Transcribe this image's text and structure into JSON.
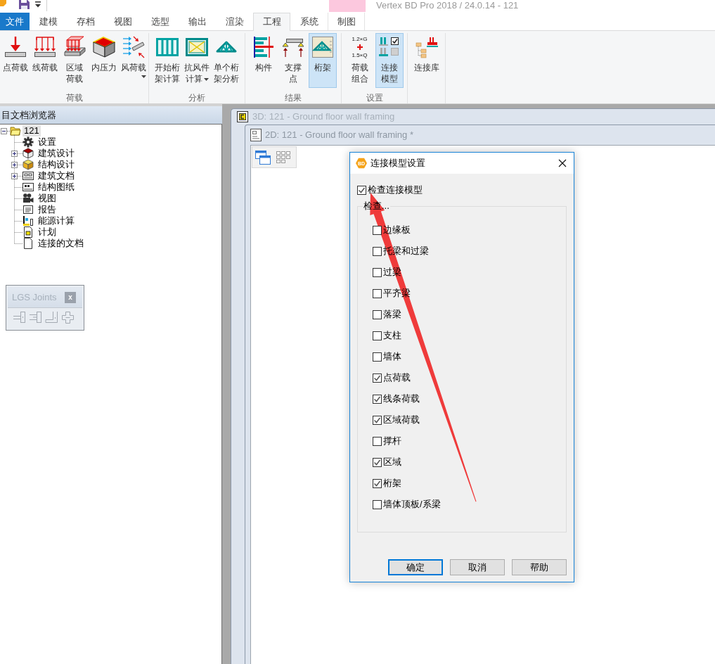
{
  "title_bar": {
    "title": "Vertex BD Pro 2018 / 24.0.14 - 121"
  },
  "ribbon": {
    "tabs": [
      {
        "label": "文件",
        "kind": "backstage",
        "selected": false
      },
      {
        "label": "建模",
        "kind": "tab",
        "selected": false
      },
      {
        "label": "存档",
        "kind": "tab",
        "selected": false
      },
      {
        "label": "视图",
        "kind": "tab",
        "selected": false
      },
      {
        "label": "选型",
        "kind": "tab",
        "selected": false
      },
      {
        "label": "输出",
        "kind": "tab",
        "selected": false
      },
      {
        "label": "渲染",
        "kind": "tab",
        "selected": false
      },
      {
        "label": "工程",
        "kind": "tab",
        "selected": true
      },
      {
        "label": "系统",
        "kind": "tab",
        "selected": false
      },
      {
        "label": "制图",
        "kind": "contextual",
        "selected": false
      }
    ],
    "groups": [
      {
        "label": "荷载",
        "buttons": [
          {
            "label": "点荷载",
            "wrapped": false,
            "dropdown": false,
            "pressed": false
          },
          {
            "label": "线荷载",
            "wrapped": false,
            "dropdown": false,
            "pressed": false
          },
          {
            "label": "区域荷载",
            "wrapped": true,
            "dropdown": false,
            "pressed": false
          },
          {
            "label": "内压力",
            "wrapped": false,
            "dropdown": false,
            "pressed": false
          },
          {
            "label": "风荷载",
            "wrapped": false,
            "dropdown": true,
            "pressed": false
          }
        ]
      },
      {
        "label": "分析",
        "buttons": [
          {
            "label": "开始桁架计算",
            "wrapped": true,
            "dropdown": false,
            "pressed": false
          },
          {
            "label": "抗风件计算",
            "wrapped": true,
            "dropdown": true,
            "pressed": false
          },
          {
            "label": "单个桁架分析",
            "wrapped": true,
            "dropdown": false,
            "pressed": false
          }
        ]
      },
      {
        "label": "结果",
        "buttons": [
          {
            "label": "构件",
            "wrapped": false,
            "dropdown": false,
            "pressed": false
          },
          {
            "label": "支撑点",
            "wrapped": true,
            "dropdown": false,
            "pressed": false
          },
          {
            "label": "桁架",
            "wrapped": false,
            "dropdown": false,
            "pressed": true
          }
        ]
      },
      {
        "label": "设置",
        "buttons": [
          {
            "label": "荷载组合",
            "icon_text": [
              "1.2×G",
              "1.5×Q"
            ],
            "wrapped": true,
            "dropdown": false,
            "pressed": false
          },
          {
            "label": "连接模型",
            "wrapped": true,
            "dropdown": false,
            "pressed": true
          }
        ]
      },
      {
        "buttons": [
          {
            "label": "连接库",
            "wrapped": false,
            "dropdown": false,
            "pressed": false
          }
        ]
      }
    ]
  },
  "browser": {
    "title": "目文档浏览器",
    "tree": {
      "label": "121",
      "expanded": true,
      "selected": true,
      "children": [
        {
          "label": "设置",
          "kind": "leaf",
          "selected": false
        },
        {
          "label": "建筑设计",
          "kind": "branch",
          "expanded": false,
          "selected": false
        },
        {
          "label": "结构设计",
          "kind": "branch",
          "expanded": false,
          "selected": false
        },
        {
          "label": "建筑文档",
          "kind": "branch",
          "expanded": false,
          "selected": false
        },
        {
          "label": "结构图纸",
          "kind": "leaf",
          "selected": false
        },
        {
          "label": "视图",
          "kind": "leaf",
          "selected": false
        },
        {
          "label": "报告",
          "kind": "leaf",
          "selected": false
        },
        {
          "label": "能源计算",
          "kind": "leaf",
          "selected": false
        },
        {
          "label": "计划",
          "kind": "leaf",
          "selected": false
        },
        {
          "label": "连接的文档",
          "kind": "leaf",
          "selected": false
        }
      ]
    }
  },
  "joints_toolbar": {
    "title": "LGS Joints",
    "close": "x"
  },
  "windows": [
    {
      "title": "3D: 121 - Ground floor wall framing"
    },
    {
      "title": "2D: 121 - Ground floor wall framing *"
    }
  ],
  "dialog": {
    "logo": "BD",
    "title": "连接模型设置",
    "main_check": {
      "label": "检查连接模型",
      "checked": true
    },
    "group_label": "检查...",
    "options": [
      {
        "label": "边缘板",
        "checked": false
      },
      {
        "label": "托梁和过梁",
        "checked": false
      },
      {
        "label": "过梁",
        "checked": false
      },
      {
        "label": "平齐梁",
        "checked": false
      },
      {
        "label": "落梁",
        "checked": false
      },
      {
        "label": "支柱",
        "checked": false
      },
      {
        "label": "墙体",
        "checked": false
      },
      {
        "label": "点荷载",
        "checked": true
      },
      {
        "label": "线条荷载",
        "checked": true
      },
      {
        "label": "区域荷载",
        "checked": true
      },
      {
        "label": "撑杆",
        "checked": false
      },
      {
        "label": "区域",
        "checked": true
      },
      {
        "label": "桁架",
        "checked": true
      },
      {
        "label": "墙体顶板/系梁",
        "checked": false
      }
    ],
    "buttons": [
      {
        "label": "确定",
        "default": true
      },
      {
        "label": "取消",
        "default": false
      },
      {
        "label": "帮助",
        "default": false
      }
    ]
  }
}
